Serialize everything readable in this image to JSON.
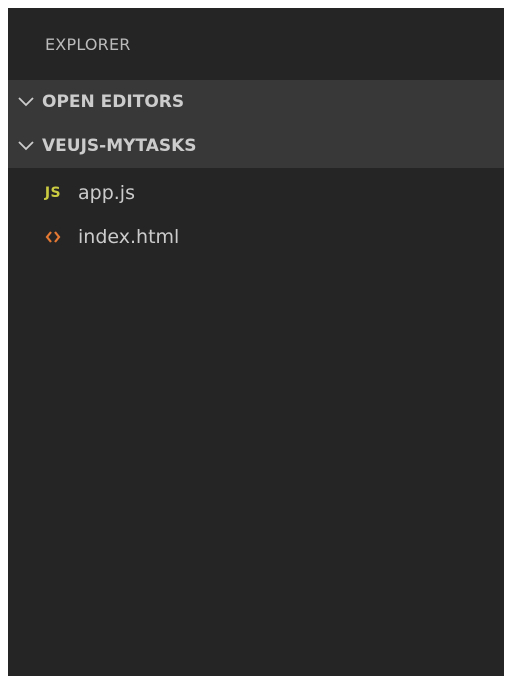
{
  "explorer": {
    "title": "EXPLORER",
    "sections": [
      {
        "label": "OPEN EDITORS",
        "expanded": true,
        "icon": "chevron-down-icon"
      },
      {
        "label": "VEUJS-MYTASKS",
        "expanded": true,
        "icon": "chevron-down-icon"
      }
    ],
    "files": [
      {
        "name": "app.js",
        "icon": "javascript-file-icon",
        "badge": "JS",
        "color": "#cbcb41"
      },
      {
        "name": "index.html",
        "icon": "html-file-icon",
        "color": "#e37933"
      }
    ]
  },
  "colors": {
    "background": "#252526",
    "section_header": "#383838",
    "text": "#cccccc"
  }
}
